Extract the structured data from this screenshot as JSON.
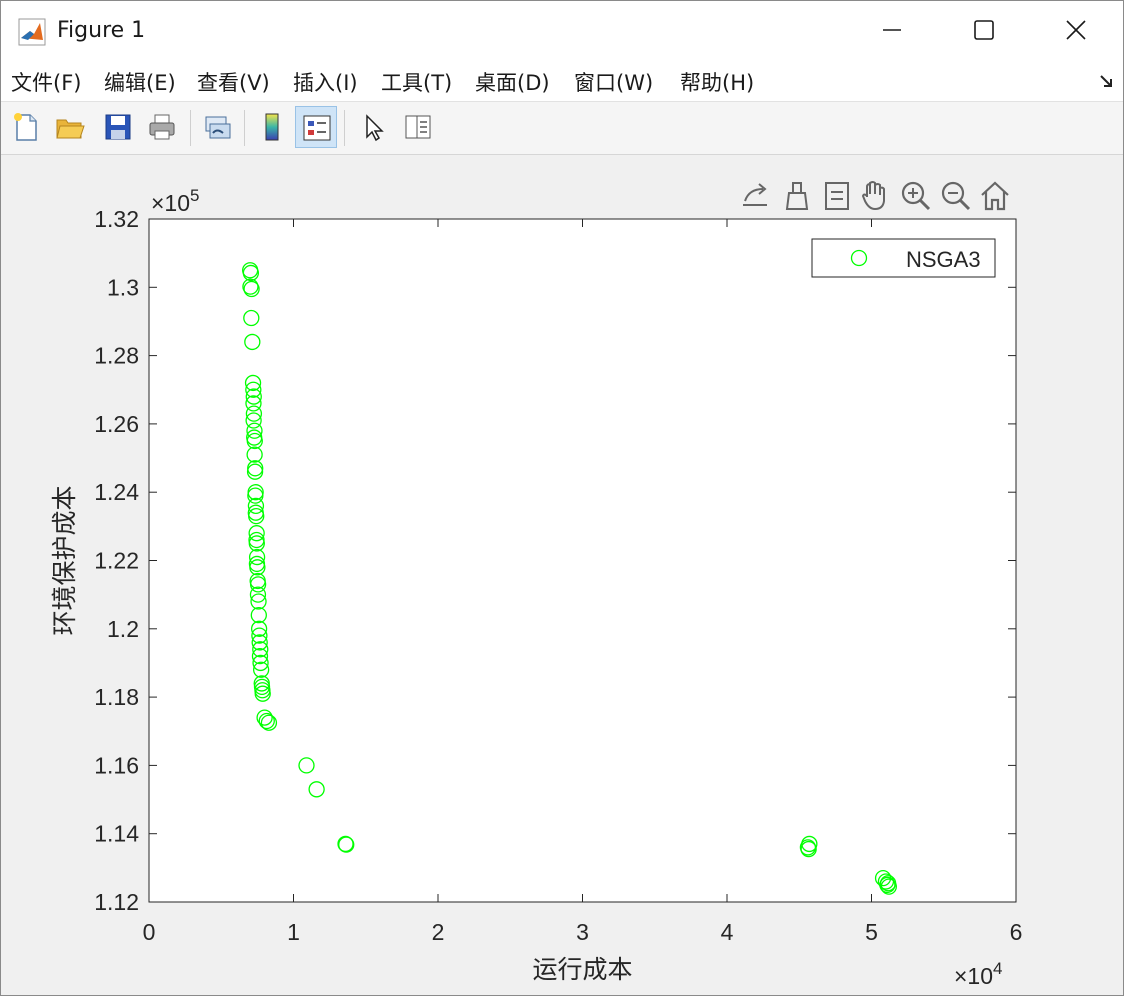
{
  "window": {
    "title": "Figure 1",
    "icon": "matlab-icon",
    "controls": [
      "minimize-icon",
      "maximize-icon",
      "close-icon"
    ]
  },
  "menu": {
    "items": [
      "文件(F)",
      "编辑(E)",
      "查看(V)",
      "插入(I)",
      "工具(T)",
      "桌面(D)",
      "窗口(W)",
      "帮助(H)"
    ]
  },
  "toolbar": {
    "buttons": [
      "new-figure-icon",
      "open-file-icon",
      "save-icon",
      "print-icon",
      "link-plot-icon",
      "insert-colorbar-icon",
      "insert-legend-icon",
      "edit-plot-icon",
      "property-inspector-icon"
    ],
    "active": "insert-legend-icon"
  },
  "axes_toolbar": {
    "buttons": [
      "export-icon",
      "brush-icon",
      "data-tips-icon",
      "pan-icon",
      "zoom-in-icon",
      "zoom-out-icon",
      "home-icon"
    ]
  },
  "chart_data": {
    "type": "scatter",
    "title": "",
    "xlabel": "运行成本",
    "ylabel": "环境保护成本",
    "xlim": [
      0,
      60000
    ],
    "ylim": [
      112000,
      132000
    ],
    "x_ticks": [
      "0",
      "1",
      "2",
      "3",
      "4",
      "5",
      "6"
    ],
    "y_ticks": [
      "1.12",
      "1.14",
      "1.16",
      "1.18",
      "1.2",
      "1.22",
      "1.24",
      "1.26",
      "1.28",
      "1.3",
      "1.32"
    ],
    "x_exponent": "×10^4",
    "y_exponent": "×10^5",
    "legend_position": "top-right",
    "grid": false,
    "series": [
      {
        "name": "NSGA3",
        "color": "#00ff00",
        "marker": "circle-open",
        "points": [
          [
            7000,
            130500
          ],
          [
            7050,
            130420
          ],
          [
            7020,
            130020
          ],
          [
            7100,
            129950
          ],
          [
            7080,
            129100
          ],
          [
            7150,
            128400
          ],
          [
            7200,
            127200
          ],
          [
            7220,
            127000
          ],
          [
            7250,
            126800
          ],
          [
            7230,
            126600
          ],
          [
            7260,
            126300
          ],
          [
            7240,
            126100
          ],
          [
            7300,
            125800
          ],
          [
            7280,
            125600
          ],
          [
            7320,
            125500
          ],
          [
            7310,
            125100
          ],
          [
            7350,
            124700
          ],
          [
            7340,
            124600
          ],
          [
            7380,
            124000
          ],
          [
            7360,
            123900
          ],
          [
            7400,
            123600
          ],
          [
            7390,
            123400
          ],
          [
            7420,
            123300
          ],
          [
            7450,
            122800
          ],
          [
            7440,
            122600
          ],
          [
            7460,
            122500
          ],
          [
            7480,
            122100
          ],
          [
            7470,
            121900
          ],
          [
            7500,
            121800
          ],
          [
            7520,
            121400
          ],
          [
            7550,
            121300
          ],
          [
            7540,
            121000
          ],
          [
            7580,
            120800
          ],
          [
            7600,
            120400
          ],
          [
            7620,
            120000
          ],
          [
            7640,
            119800
          ],
          [
            7660,
            119600
          ],
          [
            7700,
            119400
          ],
          [
            7680,
            119200
          ],
          [
            7720,
            119000
          ],
          [
            7760,
            118800
          ],
          [
            7800,
            118400
          ],
          [
            7820,
            118300
          ],
          [
            7850,
            118200
          ],
          [
            7870,
            118100
          ],
          [
            8000,
            117400
          ],
          [
            8150,
            117300
          ],
          [
            8300,
            117250
          ],
          [
            10900,
            116000
          ],
          [
            11600,
            115300
          ],
          [
            13600,
            113700
          ],
          [
            13650,
            113680
          ],
          [
            45600,
            113600
          ],
          [
            45700,
            113700
          ],
          [
            45650,
            113550
          ],
          [
            50800,
            112700
          ],
          [
            51000,
            112600
          ],
          [
            51100,
            112500
          ],
          [
            51200,
            112450
          ],
          [
            51150,
            112550
          ]
        ]
      }
    ]
  }
}
